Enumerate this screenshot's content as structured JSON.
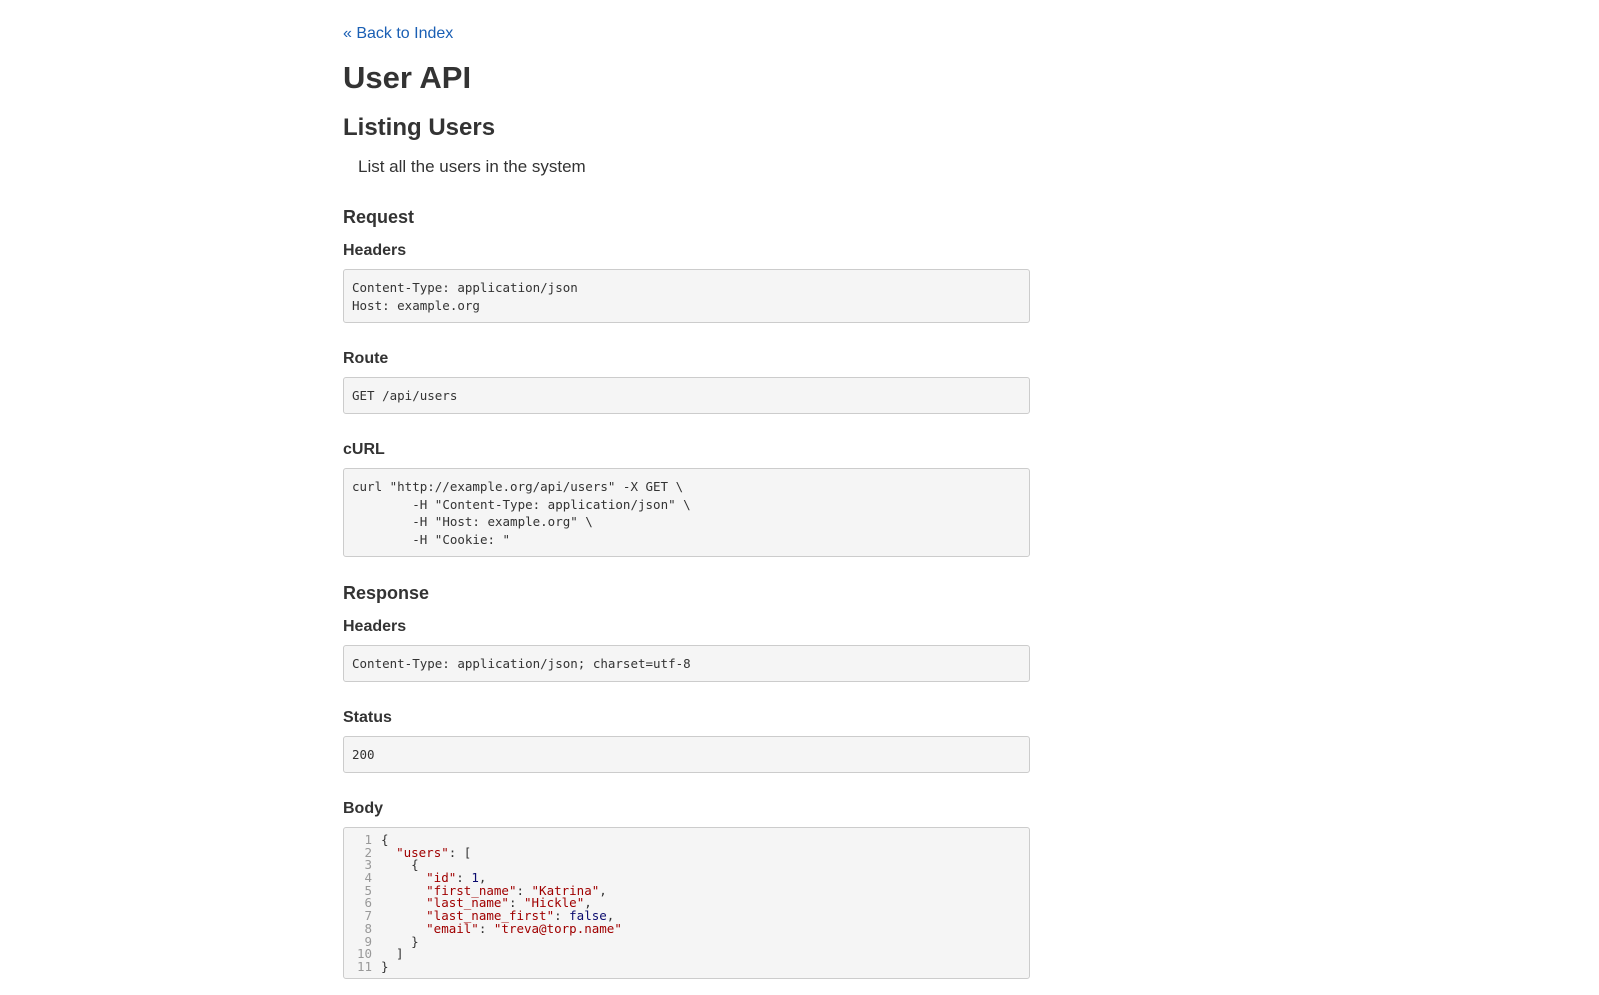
{
  "nav": {
    "back_label": "« Back to Index"
  },
  "page": {
    "title": "User API",
    "section_title": "Listing Users",
    "explanation": "List all the users in the system"
  },
  "request": {
    "heading": "Request",
    "headers_label": "Headers",
    "headers": "Content-Type: application/json\nHost: example.org",
    "route_label": "Route",
    "route": "GET /api/users",
    "curl_label": "cURL",
    "curl": "curl \"http://example.org/api/users\" -X GET \\\n\t-H \"Content-Type: application/json\" \\\n\t-H \"Host: example.org\" \\\n\t-H \"Cookie: \""
  },
  "response": {
    "heading": "Response",
    "headers_label": "Headers",
    "headers": "Content-Type: application/json; charset=utf-8",
    "status_label": "Status",
    "status": "200",
    "body_label": "Body",
    "body_line_numbers": [
      "1",
      "2",
      "3",
      "4",
      "5",
      "6",
      "7",
      "8",
      "9",
      "10",
      "11"
    ],
    "body": {
      "users_key": "\"users\"",
      "id_key": "\"id\"",
      "id_value": "1",
      "first_name_key": "\"first_name\"",
      "first_name_value": "\"Katrina\"",
      "last_name_key": "\"last_name\"",
      "last_name_value": "\"Hickle\"",
      "last_name_first_key": "\"last_name_first\"",
      "last_name_first_value": "false",
      "email_key": "\"email\"",
      "email_value": "\"treva@torp.name\""
    }
  },
  "colors": {
    "link": "#1a5fb4",
    "text": "#333333",
    "code_background": "#f5f5f5",
    "code_border": "#cccccc",
    "json_key": "#a00000",
    "json_value": "#0a0a6e"
  }
}
